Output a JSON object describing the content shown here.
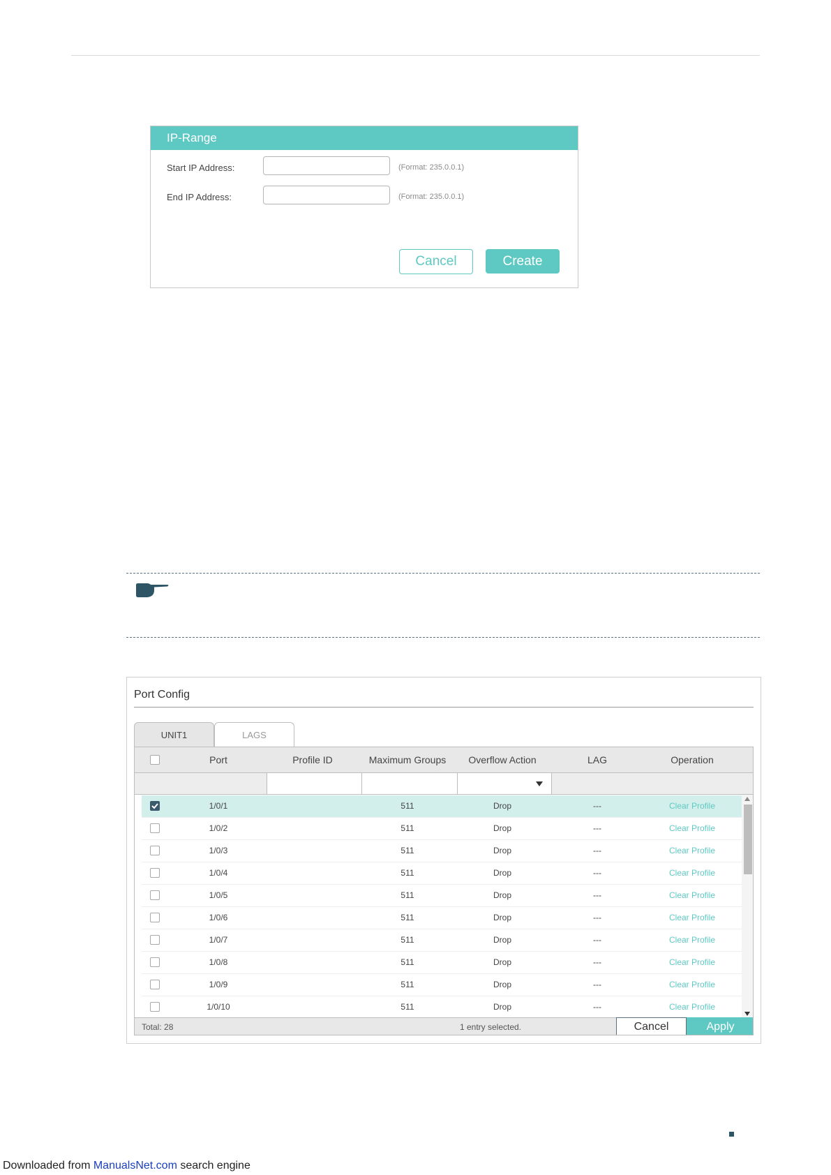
{
  "dialog": {
    "title": "IP-Range",
    "start_label": "Start IP Address:",
    "start_value": "",
    "start_hint": "(Format: 235.0.0.1)",
    "end_label": "End IP Address:",
    "end_value": "",
    "end_hint": "(Format: 235.0.0.1)",
    "cancel_label": "Cancel",
    "create_label": "Create"
  },
  "port_config": {
    "title": "Port Config",
    "tabs": [
      {
        "label": "UNIT1",
        "active": true
      },
      {
        "label": "LAGS",
        "active": false
      }
    ],
    "columns": [
      "Port",
      "Profile ID",
      "Maximum Groups",
      "Overflow Action",
      "LAG",
      "Operation"
    ],
    "rows": [
      {
        "checked": true,
        "port": "1/0/1",
        "profile_id": "",
        "max_groups": "511",
        "overflow": "Drop",
        "lag": "---",
        "operation": "Clear Profile"
      },
      {
        "checked": false,
        "port": "1/0/2",
        "profile_id": "",
        "max_groups": "511",
        "overflow": "Drop",
        "lag": "---",
        "operation": "Clear Profile"
      },
      {
        "checked": false,
        "port": "1/0/3",
        "profile_id": "",
        "max_groups": "511",
        "overflow": "Drop",
        "lag": "---",
        "operation": "Clear Profile"
      },
      {
        "checked": false,
        "port": "1/0/4",
        "profile_id": "",
        "max_groups": "511",
        "overflow": "Drop",
        "lag": "---",
        "operation": "Clear Profile"
      },
      {
        "checked": false,
        "port": "1/0/5",
        "profile_id": "",
        "max_groups": "511",
        "overflow": "Drop",
        "lag": "---",
        "operation": "Clear Profile"
      },
      {
        "checked": false,
        "port": "1/0/6",
        "profile_id": "",
        "max_groups": "511",
        "overflow": "Drop",
        "lag": "---",
        "operation": "Clear Profile"
      },
      {
        "checked": false,
        "port": "1/0/7",
        "profile_id": "",
        "max_groups": "511",
        "overflow": "Drop",
        "lag": "---",
        "operation": "Clear Profile"
      },
      {
        "checked": false,
        "port": "1/0/8",
        "profile_id": "",
        "max_groups": "511",
        "overflow": "Drop",
        "lag": "---",
        "operation": "Clear Profile"
      },
      {
        "checked": false,
        "port": "1/0/9",
        "profile_id": "",
        "max_groups": "511",
        "overflow": "Drop",
        "lag": "---",
        "operation": "Clear Profile"
      },
      {
        "checked": false,
        "port": "1/0/10",
        "profile_id": "",
        "max_groups": "511",
        "overflow": "Drop",
        "lag": "---",
        "operation": "Clear Profile"
      }
    ],
    "total": "Total: 28",
    "selected": "1 entry selected.",
    "cancel_label": "Cancel",
    "apply_label": "Apply"
  },
  "note_icon": "pointing-hand-icon",
  "footer": {
    "prefix": "Downloaded from ",
    "link": "ManualsNet.com",
    "suffix": " search engine"
  },
  "colors": {
    "accent": "#5ec8c3",
    "selected_row": "#d3efec",
    "checkbox_on": "#3b5a6e",
    "note_icon": "#2e5566"
  }
}
